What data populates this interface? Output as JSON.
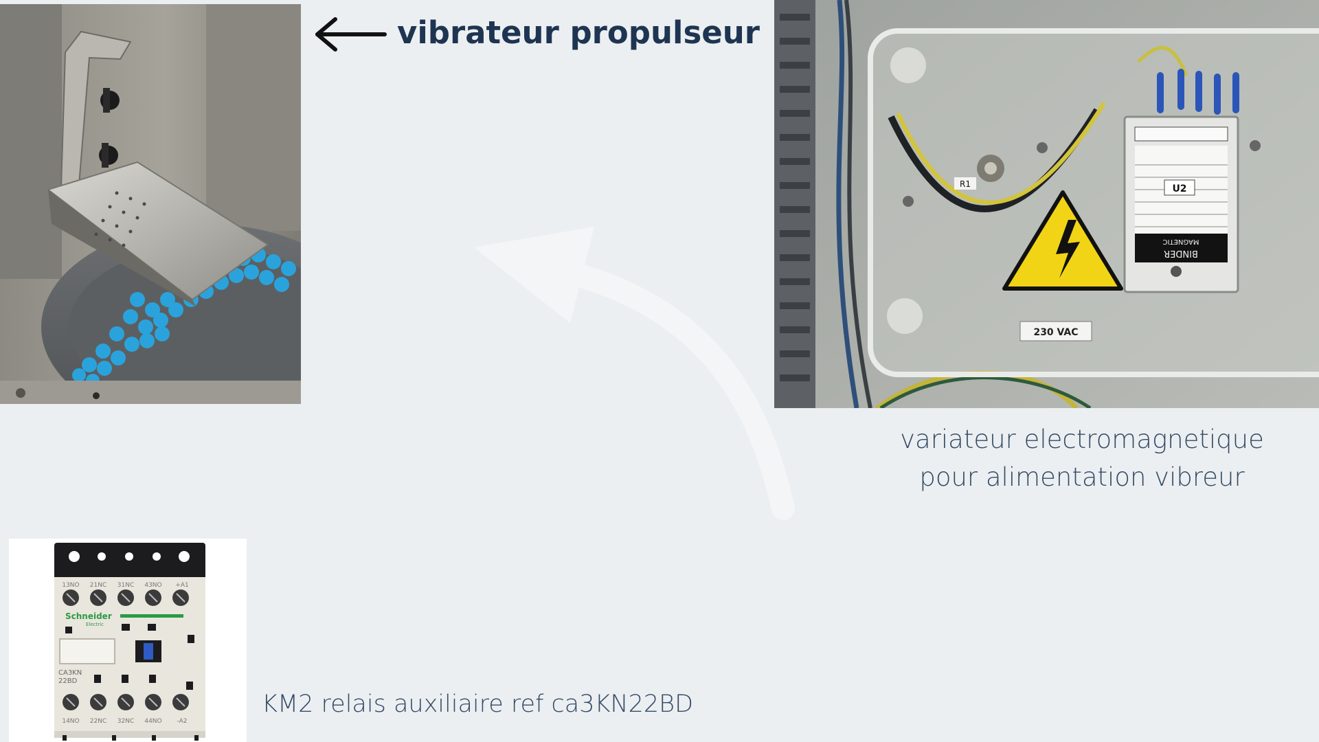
{
  "slide": {
    "background_color": "#eceff1",
    "text_color_heading": "#1e3552",
    "text_color_caption": "#334a66"
  },
  "feeder_photo": {
    "heading": "vibrateur propulseur",
    "arrow_icon": "arrow-left-icon"
  },
  "regulator_photo": {
    "label_r1": "R1",
    "label_u2": "U2",
    "label_voltage": "230 VAC",
    "label_brand": "BINDER",
    "label_brand_sub": "MAGNETIC",
    "warning_icon": "high-voltage-warning-icon",
    "caption_line1": "variateur electromagnetique",
    "caption_line2": "pour alimentation vibreur"
  },
  "relay_photo": {
    "brand": "Schneider",
    "brand_sub": "Electric",
    "model_line1": "CA3KN",
    "model_line2": "22BD",
    "terminal_labels_top": [
      "13NO",
      "21NC",
      "31NC",
      "43NO",
      "+A1"
    ],
    "terminal_labels_bottom": [
      "14NO",
      "22NC",
      "32NC",
      "44NO",
      "-A2"
    ],
    "caption": "KM2 relais auxiliaire ref ca3KN22BD"
  }
}
